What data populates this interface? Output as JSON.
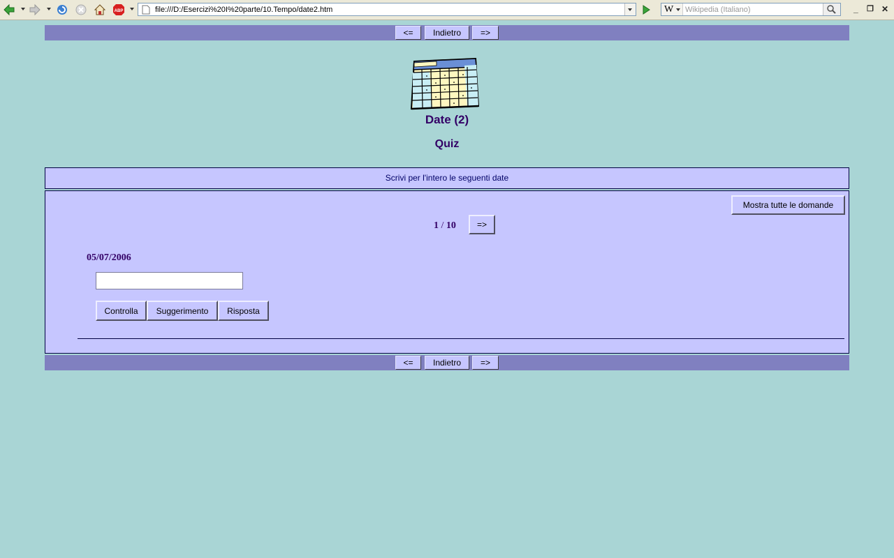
{
  "browser": {
    "url": "file:///D:/Esercizi%20I%20parte/10.Tempo/date2.htm",
    "search_placeholder": "Wikipedia (Italiano)",
    "search_engine_label": "W"
  },
  "nav": {
    "prev_label": "<=",
    "back_label": "Indietro",
    "next_label": "=>"
  },
  "header": {
    "title": "Date (2)",
    "subtitle": "Quiz"
  },
  "instructions": "Scrivi per l'intero le seguenti date",
  "quiz": {
    "show_all_label": "Mostra tutte le domande",
    "current": "1",
    "separator": "/",
    "total": "10",
    "next_label": "=>",
    "question": "05/07/2006",
    "answer_value": "",
    "check_label": "Controlla",
    "hint_label": "Suggerimento",
    "answer_label": "Risposta"
  },
  "colors": {
    "page_bg": "#a9d5d5",
    "navbar_bg": "#8080c0",
    "panel_bg": "#c6c6ff",
    "title_text": "#330066"
  }
}
